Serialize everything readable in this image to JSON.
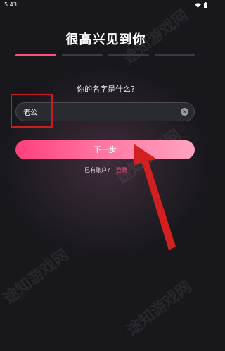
{
  "status_bar": {
    "time": "5:43"
  },
  "onboarding": {
    "title": "很高兴见到你",
    "progress": {
      "total_steps": 4,
      "current_step": 1
    },
    "question": "你的名字是什么?",
    "name_input": {
      "value": "老公",
      "placeholder": ""
    },
    "next_button_label": "下一步",
    "have_account_text": "已有账户?",
    "login_link_label": "登录"
  },
  "watermark_text": "途知游戏网",
  "colors": {
    "accent": "#ff4d7a",
    "background": "#17171c",
    "annotation": "#c81e1e"
  }
}
